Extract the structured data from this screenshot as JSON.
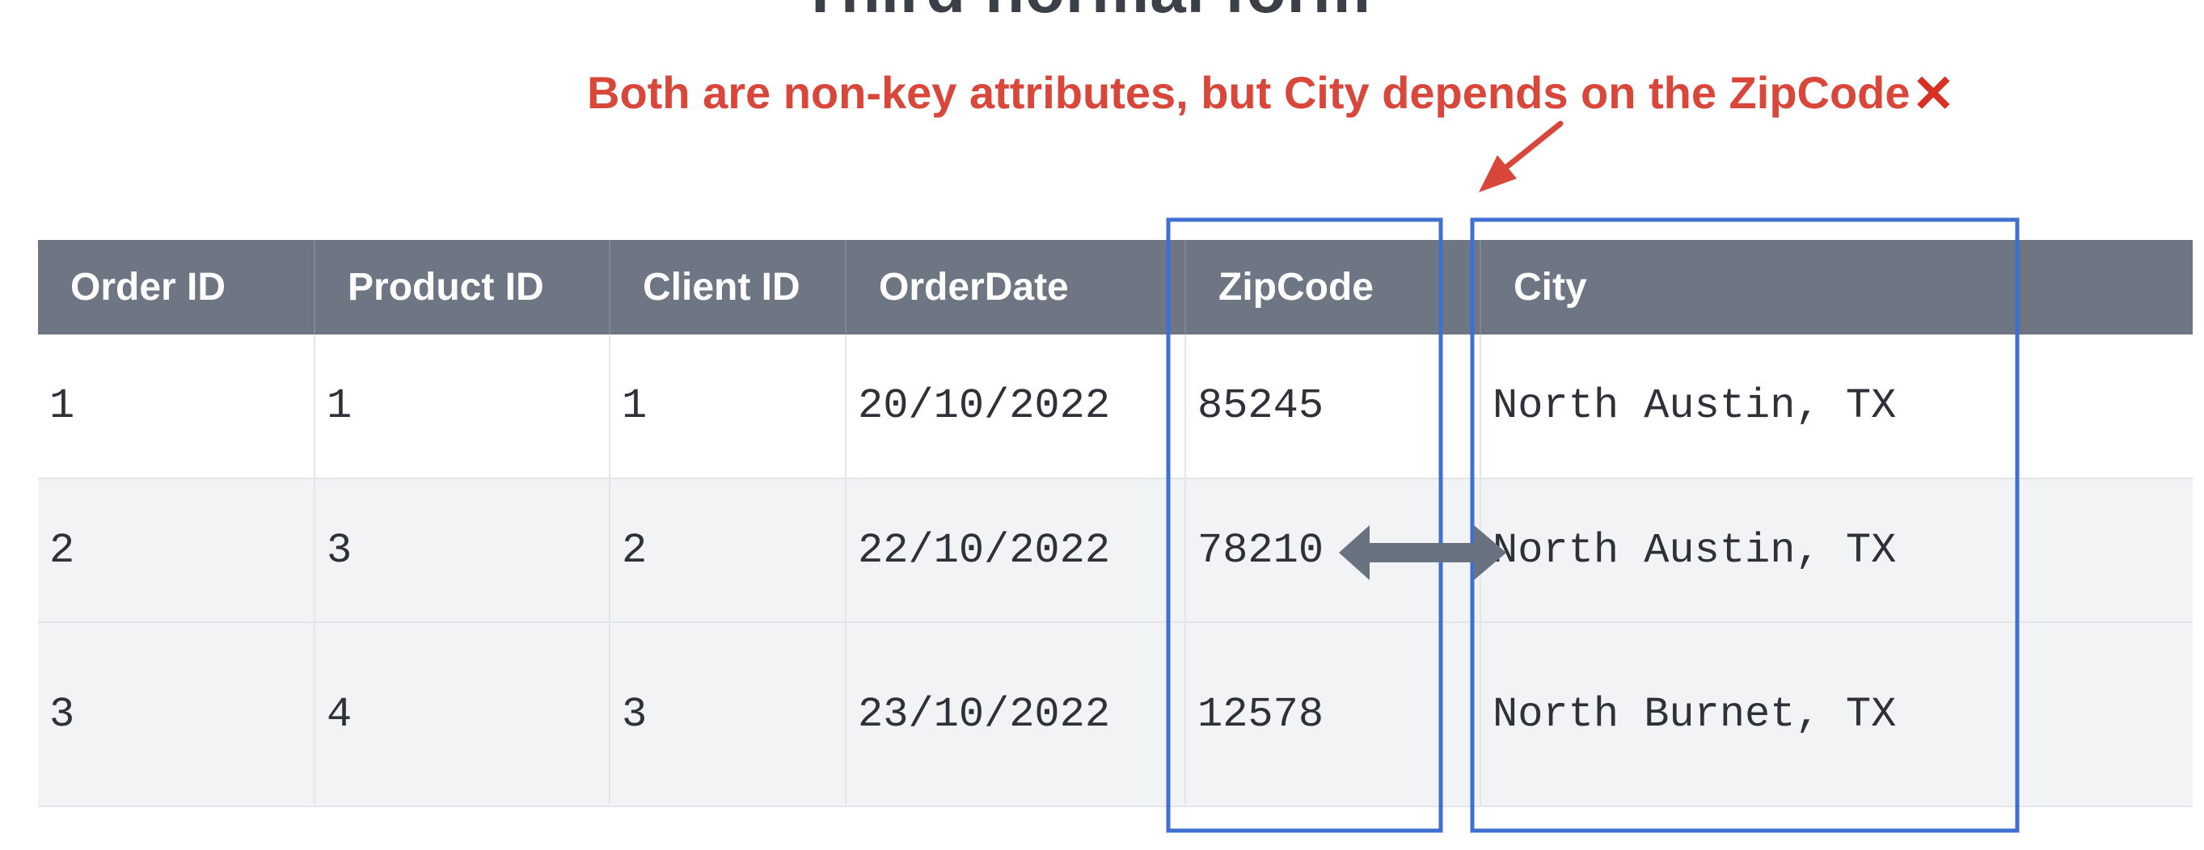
{
  "slide": {
    "title_fragment": "Third normal form"
  },
  "annotation": {
    "text": "Both are non-key attributes, but City depends on the ZipCode",
    "mark": "✕",
    "accent_color": "#d9463a"
  },
  "table": {
    "columns": [
      "Order ID",
      "Product ID",
      "Client ID",
      "OrderDate",
      "ZipCode",
      "City"
    ],
    "rows": [
      [
        "1",
        "1",
        "1",
        "20/10/2022",
        "85245",
        "North Austin, TX"
      ],
      [
        "2",
        "3",
        "2",
        "22/10/2022",
        "78210",
        "North Austin, TX"
      ],
      [
        "3",
        "4",
        "3",
        "23/10/2022",
        "12578",
        "North Burnet, TX"
      ]
    ],
    "header_color": "#6d7682",
    "highlight_color": "#3f6fd1"
  },
  "icons": {
    "pointer": "arrow-pointer-icon",
    "dependency": "double-arrow-icon",
    "cross": "x-mark-icon"
  }
}
